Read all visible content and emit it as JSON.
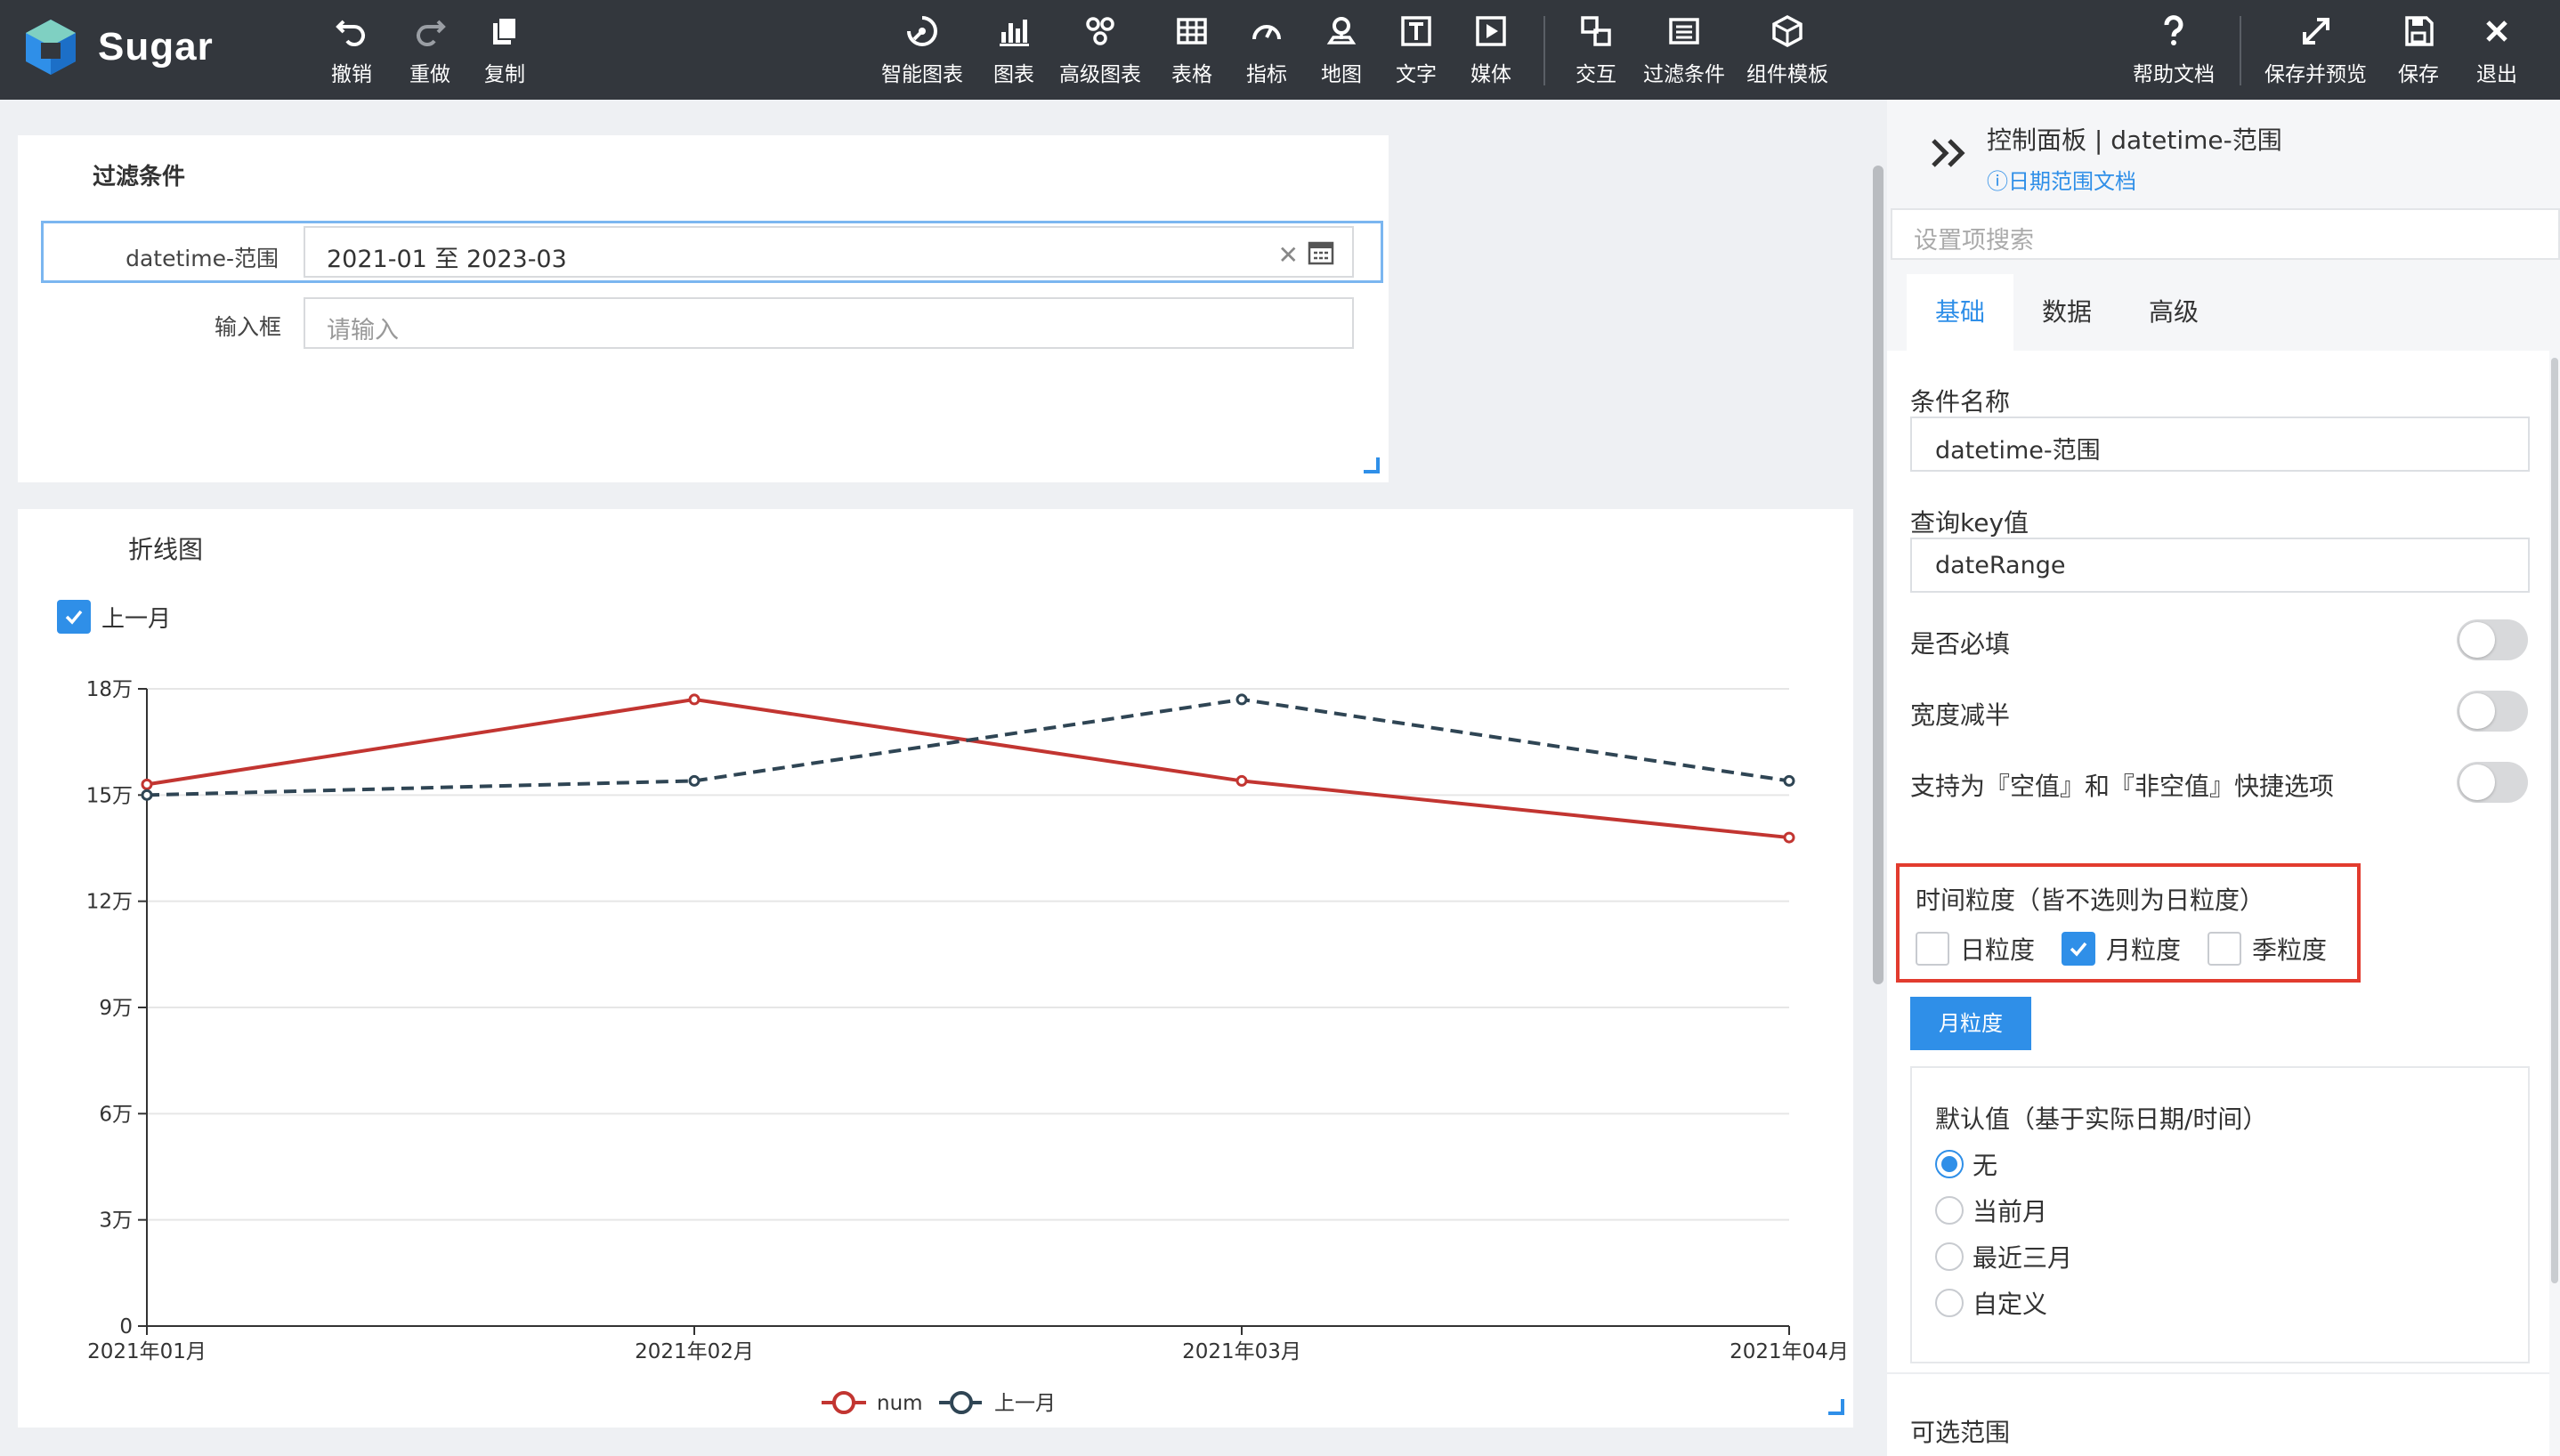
{
  "app": {
    "name": "Sugar"
  },
  "toolbar": {
    "undo": "撤销",
    "redo": "重做",
    "copy": "复制",
    "smart_chart": "智能图表",
    "chart": "图表",
    "advanced_chart": "高级图表",
    "table": "表格",
    "indicator": "指标",
    "map": "地图",
    "text": "文字",
    "media": "媒体",
    "interaction": "交互",
    "filter": "过滤条件",
    "component_template": "组件模板",
    "help_doc": "帮助文档",
    "save_preview": "保存并预览",
    "save": "保存",
    "exit": "退出"
  },
  "filter_card": {
    "title": "过滤条件",
    "date_label": "datetime-范围",
    "date_value": "2021-01 至 2023-03",
    "input_label": "输入框",
    "input_placeholder": "请输入"
  },
  "chart_card": {
    "title": "折线图",
    "compare_checkbox_label": "上一月"
  },
  "chart_data": {
    "type": "line",
    "categories": [
      "2021年01月",
      "2021年02月",
      "2021年03月",
      "2021年04月"
    ],
    "series": [
      {
        "name": "num",
        "values": [
          153000,
          177000,
          154000,
          138000
        ],
        "color": "#c23531",
        "style": "solid"
      },
      {
        "name": "上一月",
        "values": [
          150000,
          154000,
          177000,
          154000
        ],
        "color": "#2f4554",
        "style": "dashed"
      }
    ],
    "ylim": [
      0,
      180000
    ],
    "yticks": [
      0,
      30000,
      60000,
      90000,
      120000,
      150000,
      180000
    ],
    "ytick_labels": [
      "0",
      "3万",
      "6万",
      "9万",
      "12万",
      "15万",
      "18万"
    ],
    "grid": true,
    "legend": "bottom-center"
  },
  "panel": {
    "title": "控制面板 | datetime-范围",
    "doc_link": "日期范围文档",
    "search_placeholder": "设置项搜索",
    "tabs": [
      "基础",
      "数据",
      "高级"
    ],
    "condition_name_label": "条件名称",
    "condition_name_value": "datetime-范围",
    "query_key_label": "查询key值",
    "query_key_value": "dateRange",
    "required_label": "是否必填",
    "half_width_label": "宽度减半",
    "empty_option_label": "支持为『空值』和『非空值』快捷选项",
    "granularity_title": "时间粒度（皆不选则为日粒度）",
    "granularity_options": [
      "日粒度",
      "月粒度",
      "季粒度"
    ],
    "granularity_selected": "月粒度",
    "granularity_tag": "月粒度",
    "default_title": "默认值（基于实际日期/时间）",
    "default_options": [
      "无",
      "当前月",
      "最近三月",
      "自定义"
    ],
    "default_selected": "无",
    "range_label": "可选范围"
  },
  "colors": {
    "topbar": "#33373d",
    "accent": "#2f8fe8",
    "highlight_border": "#e23b2e"
  }
}
